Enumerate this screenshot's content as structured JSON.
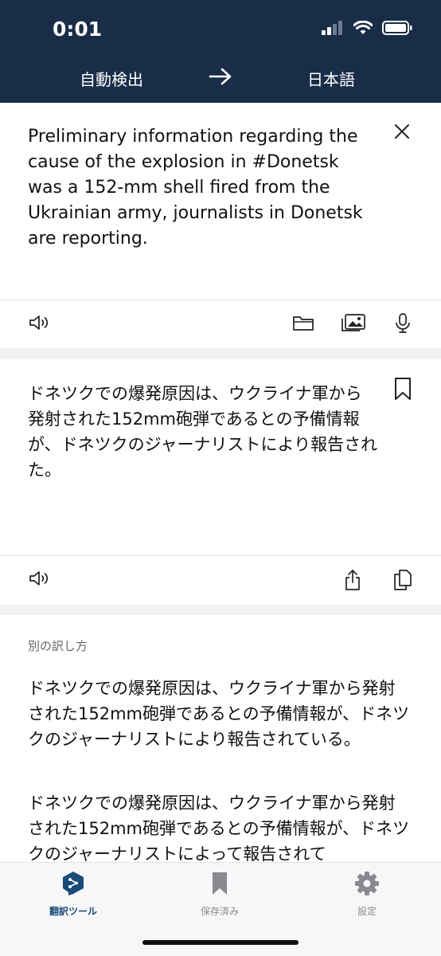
{
  "status_bar": {
    "time": "0:01"
  },
  "language_bar": {
    "source": "自動検出",
    "target": "日本語"
  },
  "source": {
    "text": "Preliminary information regarding the cause of the explosion in #Donetsk was a 152-mm shell fired from the Ukrainian army, journalists in Donetsk are reporting."
  },
  "translation": {
    "text": "ドネツクでの爆発原因は、ウクライナ軍から発射された152mm砲弾であるとの予備情報が、ドネツクのジャーナリストにより報告された。"
  },
  "alternatives": {
    "title": "別の訳し方",
    "items": [
      "ドネツクでの爆発原因は、ウクライナ軍から発射された152mm砲弾であるとの予備情報が、ドネツクのジャーナリストにより報告されている。",
      "ドネツクでの爆発原因は、ウクライナ軍から発射された152mm砲弾であるとの予備情報が、ドネツクのジャーナリストによって報告されて"
    ]
  },
  "tabs": [
    {
      "label": "翻訳ツール",
      "icon": "deepl-logo-icon",
      "active": true
    },
    {
      "label": "保存済み",
      "icon": "bookmark-icon",
      "active": false
    },
    {
      "label": "設定",
      "icon": "gear-icon",
      "active": false
    }
  ],
  "colors": {
    "header": "#1a2d48",
    "accent": "#1a4a7a",
    "background": "#f2f2f4"
  }
}
